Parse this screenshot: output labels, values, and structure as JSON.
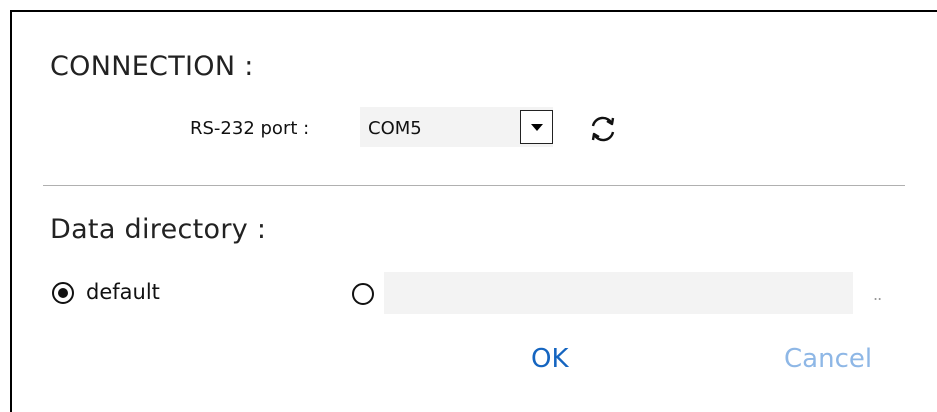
{
  "connection": {
    "title": "CONNECTION :",
    "port_label": "RS-232 port :",
    "port_value": "COM5"
  },
  "data_directory": {
    "title": "Data directory :",
    "default_label": "default",
    "default_selected": true,
    "custom_selected": false,
    "custom_path_value": "",
    "browse_label": ".."
  },
  "buttons": {
    "ok_label": "OK",
    "cancel_label": "Cancel"
  },
  "icons": {
    "dropdown": "chevron-down-icon",
    "refresh": "refresh-icon"
  },
  "colors": {
    "ok": "#1565c0",
    "cancel": "#8eb7e6",
    "field_bg": "#f3f3f3"
  }
}
